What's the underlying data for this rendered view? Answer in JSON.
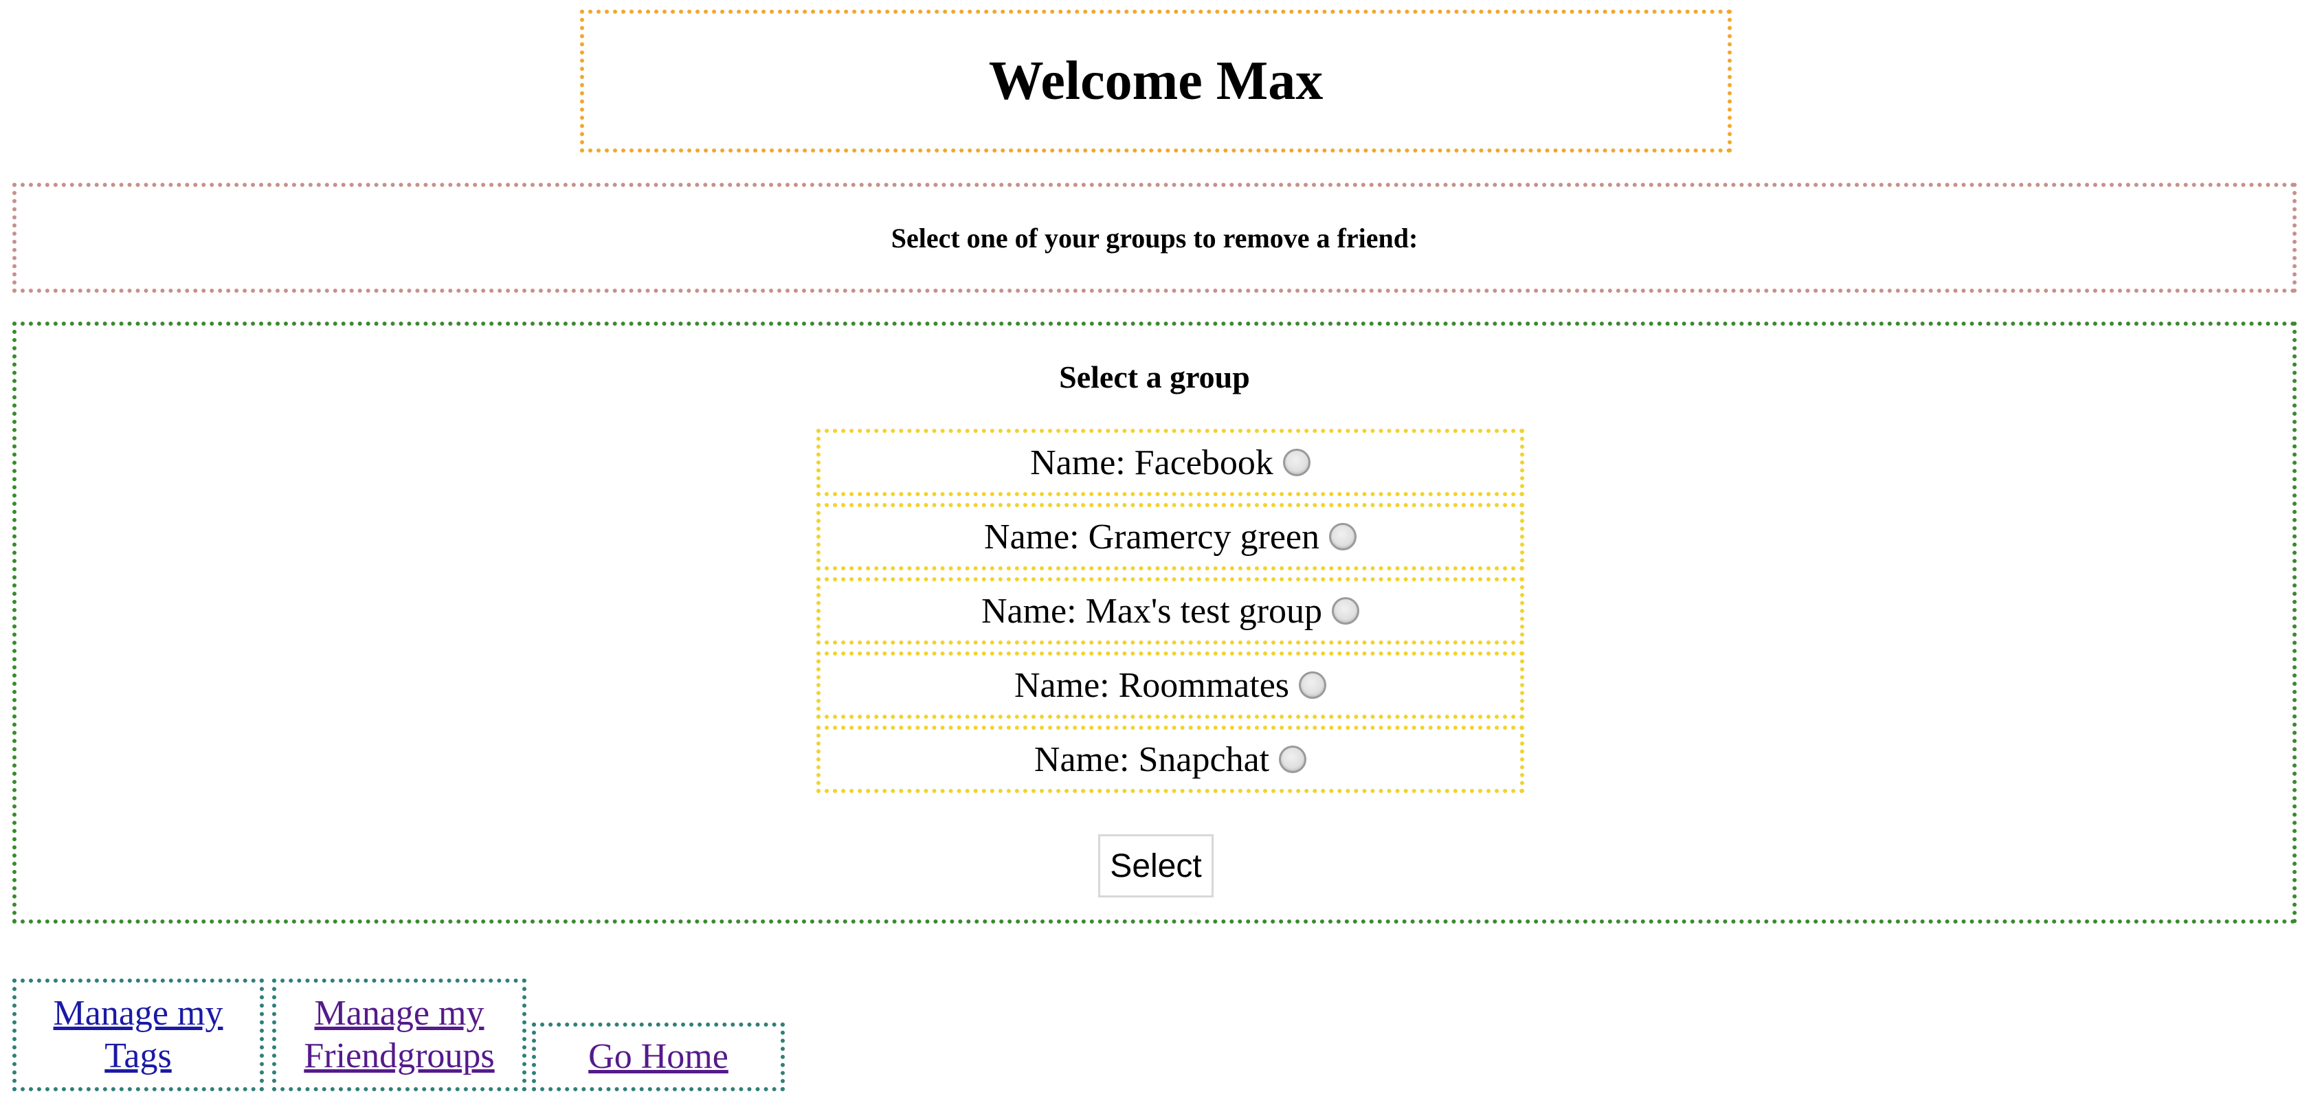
{
  "header": {
    "welcome": "Welcome Max"
  },
  "instruction": {
    "text": "Select one of your groups to remove a friend:"
  },
  "form": {
    "title": "Select a group",
    "options": [
      {
        "label": "Name: Facebook",
        "checked": false
      },
      {
        "label": "Name: Gramercy green",
        "checked": false
      },
      {
        "label": "Name: Max's test group",
        "checked": false
      },
      {
        "label": "Name: Roommates",
        "checked": false
      },
      {
        "label": "Name: Snapchat",
        "checked": false
      }
    ],
    "submit_label": "Select"
  },
  "nav": {
    "tags": "Manage my Tags",
    "friendgroups": "Manage my Friendgroups",
    "home": "Go Home"
  },
  "colors": {
    "welcome_border": "#f0a830",
    "instruction_border": "#c8908c",
    "form_border": "#3a8a2e",
    "option_border": "#f2d22e",
    "nav_border": "#2f7f7a",
    "link_unvisited": "#1a1aa6",
    "link_visited": "#551a8b"
  }
}
